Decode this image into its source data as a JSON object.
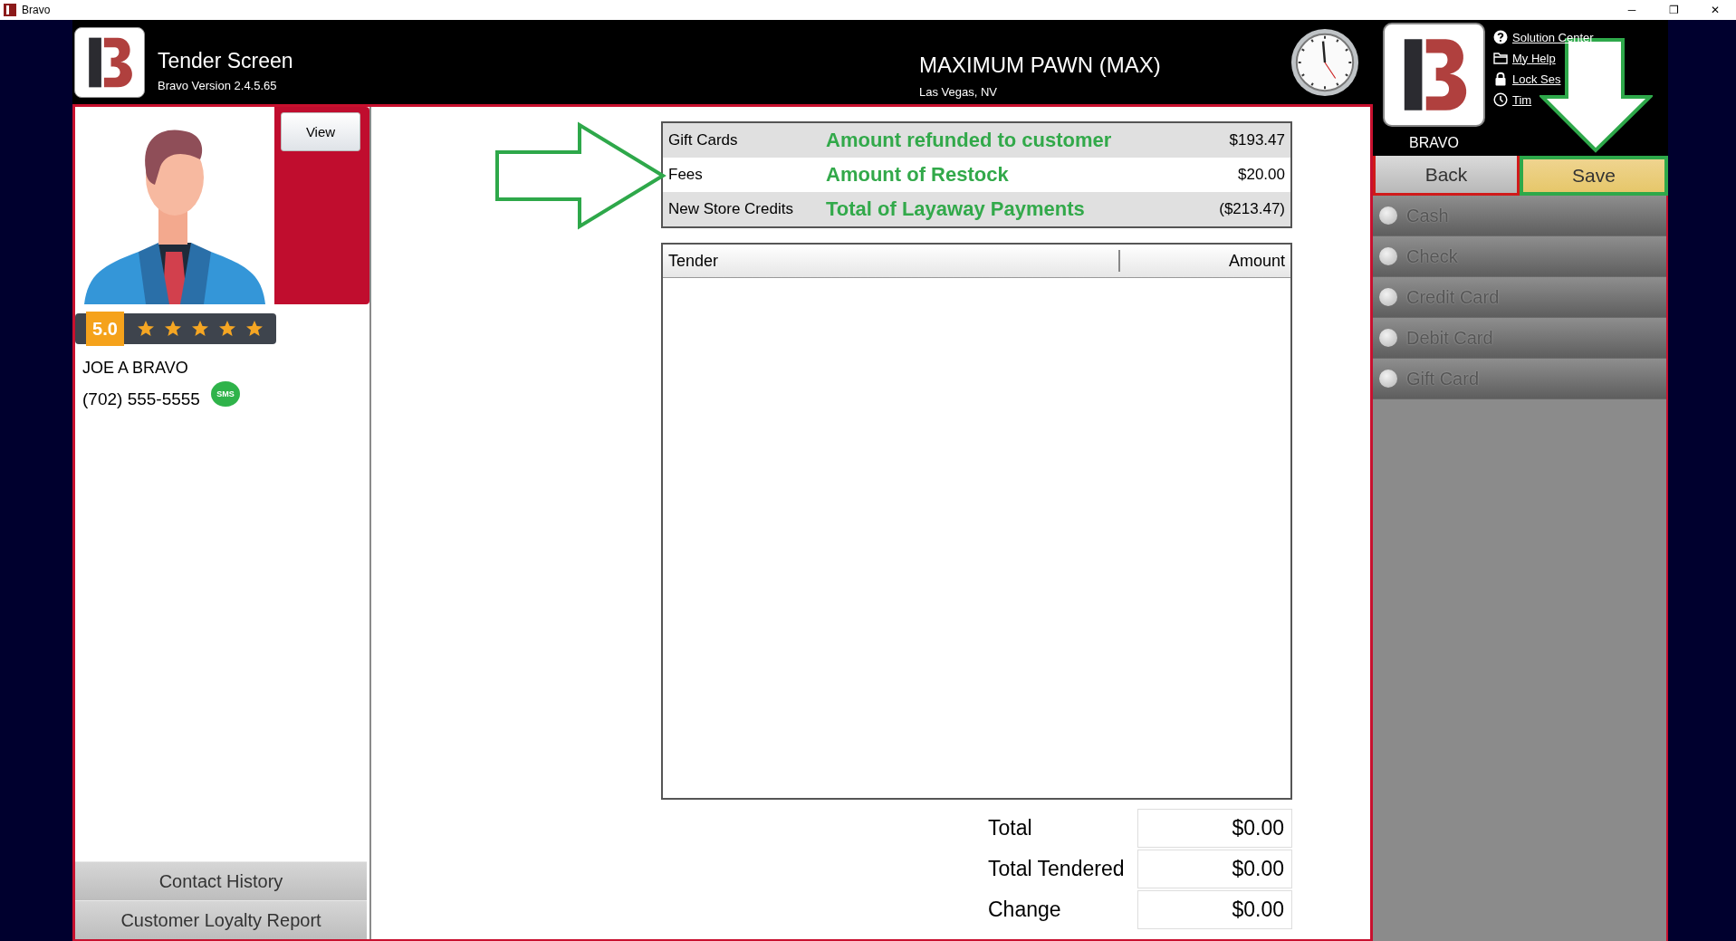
{
  "window": {
    "title": "Bravo",
    "controls": [
      "─",
      "❐",
      "✕"
    ]
  },
  "header": {
    "title": "Tender Screen",
    "version": "Bravo Version 2.4.5.65",
    "store": "MAXIMUM PAWN (MAX)",
    "location": "Las Vegas, NV",
    "brand": "BRAVO",
    "links": [
      {
        "label": "Solution Center",
        "kind": "help"
      },
      {
        "label": "My Help",
        "kind": "folder"
      },
      {
        "label": "Lock Ses",
        "kind": "lock"
      },
      {
        "label": "Tim",
        "kind": "clock"
      }
    ]
  },
  "customer": {
    "view_button": "View",
    "rating": "5.0",
    "stars": 5,
    "name": "JOE A BRAVO",
    "phone": "(702) 555-5555",
    "sms": "SMS",
    "buttons": [
      "Contact History",
      "Customer Loyalty Report"
    ]
  },
  "summary": [
    {
      "label": "Gift Cards",
      "note": "Amount refunded to customer",
      "amount": "$193.47"
    },
    {
      "label": "Fees",
      "note": "Amount of Restock",
      "amount": "$20.00"
    },
    {
      "label": "New Store Credits",
      "note": "Total of Layaway Payments",
      "amount": "($213.47)"
    }
  ],
  "tender_table": {
    "columns": [
      "Tender",
      "Amount"
    ]
  },
  "totals": [
    {
      "label": "Total",
      "value": "$0.00"
    },
    {
      "label": "Total Tendered",
      "value": "$0.00"
    },
    {
      "label": "Change",
      "value": "$0.00"
    }
  ],
  "actions": [
    {
      "label": "Back",
      "kind": "back"
    },
    {
      "label": "Save",
      "kind": "save"
    }
  ],
  "tender_types": [
    {
      "label": "Cash",
      "selected": false
    },
    {
      "label": "Check",
      "selected": false
    },
    {
      "label": "Credit Card",
      "selected": false
    },
    {
      "label": "Debit Card",
      "selected": false
    },
    {
      "label": "Gift Card",
      "selected": false
    }
  ]
}
